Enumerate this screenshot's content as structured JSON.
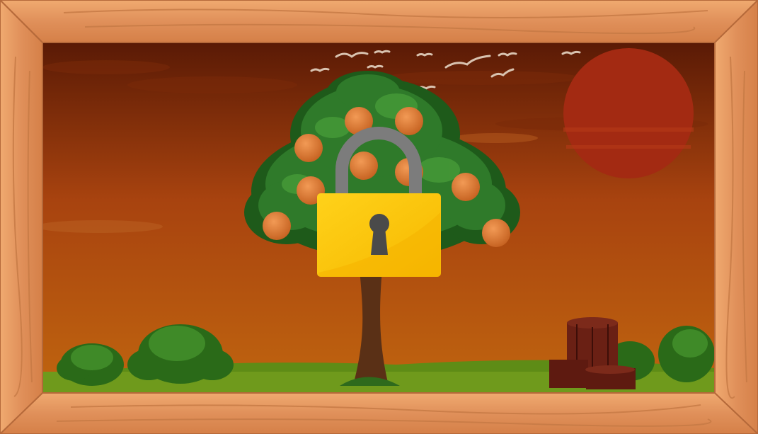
{
  "scene": {
    "name": "orange-tree-level",
    "locked": true,
    "colors": {
      "frame_wood": "#e79a5e",
      "frame_wood_dark": "#c97840",
      "sky_top": "#5a1a05",
      "sky_mid": "#a8430f",
      "sky_bottom": "#c0650f",
      "sun": "#a32a12",
      "grass": "#6f9a1c",
      "tree_leaves": "#2f7a2a",
      "orange_fruit": "#e07a2c",
      "lock_body": "#ffc400",
      "lock_shackle": "#7c7c7c",
      "keyhole": "#4a4a4a"
    },
    "icons": {
      "lock": "padlock-icon",
      "tree": "orange-tree-icon",
      "barrels": "barrels-icon"
    },
    "fruit_count": 10,
    "bird_count": 12
  }
}
